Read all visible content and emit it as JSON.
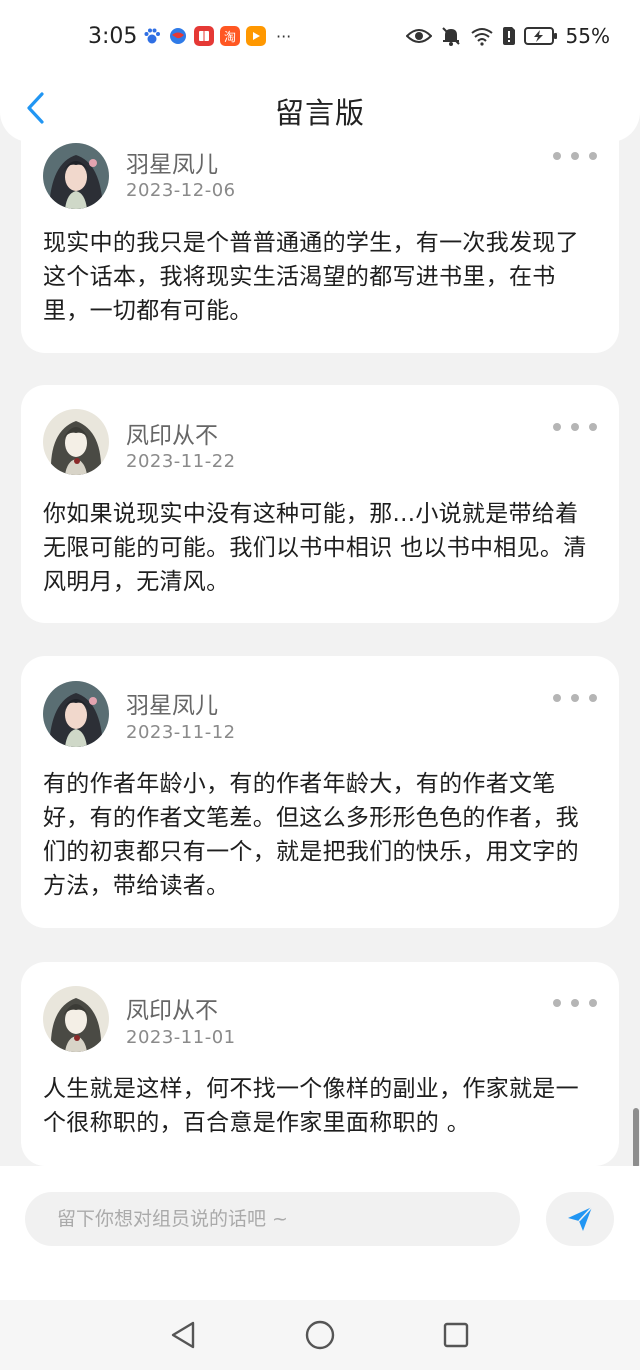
{
  "status_bar": {
    "time": "3:05",
    "app_icons": [
      "paw-app-icon",
      "globe-app-icon",
      "book-app-icon",
      "taobao-app-icon",
      "play-app-icon"
    ],
    "taobao_glyph": "淘",
    "more": "···",
    "battery_percent": "55%"
  },
  "header": {
    "title": "留言版"
  },
  "messages": [
    {
      "name": "羽星凤儿",
      "date": "2023-12-06",
      "text": "现实中的我只是个普普通通的学生，有一次我发现了这个话本，我将现实生活渴望的都写进书里，在书里，一切都有可能。"
    },
    {
      "name": "凤印从不",
      "date": "2023-11-22",
      "text": "你如果说现实中没有这种可能，那...小说就是带给着无限可能的可能。我们以书中相识 也以书中相见。清风明月，无清风。"
    },
    {
      "name": "羽星凤儿",
      "date": "2023-11-12",
      "text": "有的作者年龄小，有的作者年龄大，有的作者文笔好，有的作者文笔差。但这么多形形色色的作者，我们的初衷都只有一个，就是把我们的快乐，用文字的方法，带给读者。"
    },
    {
      "name": "凤印从不",
      "date": "2023-11-01",
      "text": "人生就是这样，何不找一个像样的副业，作家就是一个很称职的，百合意是作家里面称职的 。"
    }
  ],
  "composer": {
    "placeholder": "留下你想对组员说的话吧 ~",
    "value": ""
  },
  "colors": {
    "accent": "#2196f3",
    "background": "#f2f2f2",
    "card": "#ffffff",
    "muted_text": "#8a8a8a"
  }
}
